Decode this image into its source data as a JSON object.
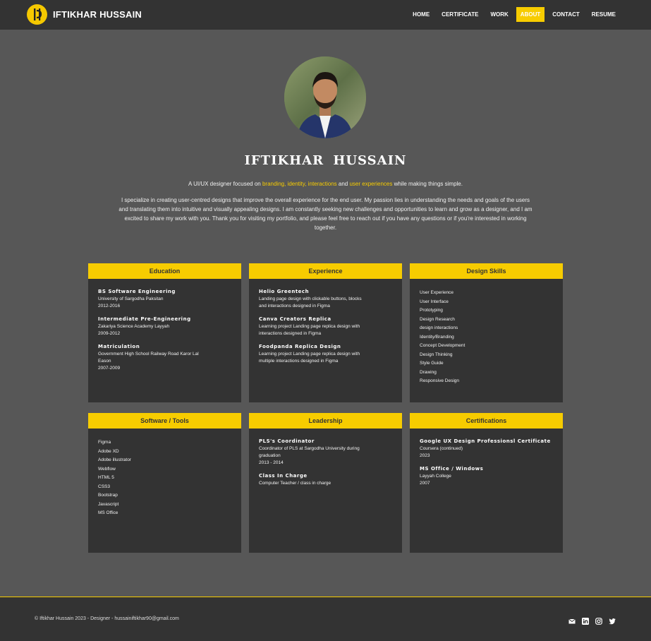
{
  "brand": {
    "name": "IFTIKHAR HUSSAIN",
    "logo_icon": "ih-monogram-icon",
    "accent": "#f7cc00"
  },
  "nav": {
    "items": [
      {
        "label": "HOME"
      },
      {
        "label": "CERTIFICATE"
      },
      {
        "label": "WORK"
      },
      {
        "label": "ABOUT",
        "active": true
      },
      {
        "label": "CONTACT"
      },
      {
        "label": "RESUME"
      }
    ]
  },
  "hero": {
    "name": "IFTIKHAR HUSSAIN",
    "tagline_prefix": "A UI/UX designer focused on ",
    "tagline_highlight_1": "branding, identity, interactions",
    "tagline_mid": " and ",
    "tagline_highlight_2": "user experiences",
    "tagline_suffix": " while making things simple.",
    "bio": "I specialize in creating user-centred designs that improve the overall experience for the end user. My passion lies in understanding the needs and goals of the users and translating them into intuitive and visually appealing designs. I am constantly seeking new challenges and opportunities to learn and grow as a designer, and I am excited to share my work with you. Thank you for visiting my portfolio, and please feel free to reach out if you have any questions or if you're interested in working together."
  },
  "cards": {
    "education": {
      "title": "Education",
      "entries": [
        {
          "title": "BS Software Engineering",
          "lines": [
            "University of Sargodha Paksitan",
            "2012-2016"
          ]
        },
        {
          "title": "Intermediate Pre-Engineering",
          "lines": [
            "Zakariya Science Academy Layyah",
            "2009-2012"
          ]
        },
        {
          "title": "Matriculation",
          "lines": [
            "Government High School Railway Road Karor Lal",
            "Eason",
            "2007-2009"
          ]
        }
      ]
    },
    "experience": {
      "title": "Experience",
      "entries": [
        {
          "title": "Helio Greentech",
          "lines": [
            "Landing page design with clickable buttons, blocks",
            "and interactions designed in Figma"
          ]
        },
        {
          "title": "Canva Creators Replica",
          "lines": [
            "Learning project Landing page replica design with",
            "interactions designed in Figma"
          ]
        },
        {
          "title": "Foodpanda Replica Design",
          "lines": [
            "Learning project Landing page replica design with",
            "multiple interactions designed in Figma"
          ]
        }
      ]
    },
    "skills": {
      "title": "Design Skills",
      "items": [
        "User Experience",
        "User Interface",
        "Prototyping",
        "Design Research",
        "design interactions",
        "Identity/Branding",
        "Concept Development",
        "Design Thinking",
        "Style Guide",
        "Drawing",
        "Responsive Design"
      ]
    },
    "tools": {
      "title": "Software / Tools",
      "items": [
        "Figma",
        "Adobe XD",
        "Adobe illustrator",
        "Webflow",
        "HTML 5",
        "CSS3",
        "Bootstrap",
        "Javascript",
        "MS Office"
      ]
    },
    "leadership": {
      "title": "Leadership",
      "entries": [
        {
          "title": "PLS's Coordinator",
          "lines": [
            "Coordinator of PLS at Sargodha University during",
            "graduation",
            "2013 - 2014"
          ]
        },
        {
          "title": "Class In Charge",
          "lines": [
            "Computer Teacher / class in charge"
          ]
        }
      ]
    },
    "certifications": {
      "title": "Certifications",
      "entries": [
        {
          "title": "Google UX Design Professionsl Certificate",
          "lines": [
            "Coursera (continued)",
            "2023"
          ]
        },
        {
          "title": "MS Office / Windows",
          "lines": [
            "Layyah College",
            "2007"
          ]
        }
      ]
    }
  },
  "footer": {
    "copyright": "© Iftikhar Hussain 2023 - Designer - hussainiftikhar90@gmail.com",
    "social_icons": [
      "mail-icon",
      "linkedin-icon",
      "instagram-icon",
      "twitter-icon"
    ]
  }
}
